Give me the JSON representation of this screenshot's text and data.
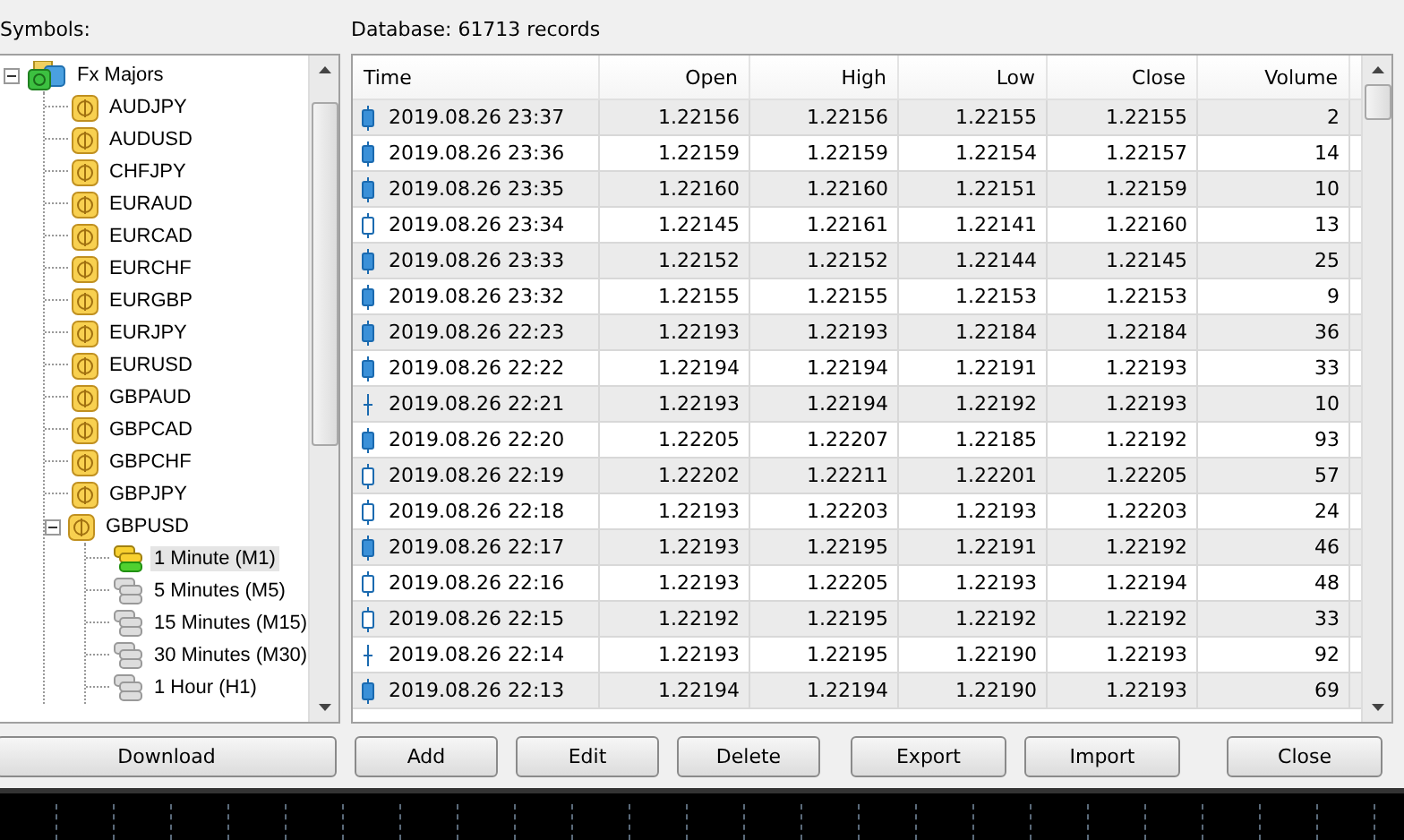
{
  "symbols_label": "Symbols:",
  "tree": [
    {
      "label": "Fx Majors",
      "kind": "folder",
      "expanded": true,
      "selected": false,
      "children": [
        {
          "label": "AUDJPY",
          "kind": "symbol",
          "selected": false
        },
        {
          "label": "AUDUSD",
          "kind": "symbol",
          "selected": false
        },
        {
          "label": "CHFJPY",
          "kind": "symbol",
          "selected": false
        },
        {
          "label": "EURAUD",
          "kind": "symbol",
          "selected": false
        },
        {
          "label": "EURCAD",
          "kind": "symbol",
          "selected": false
        },
        {
          "label": "EURCHF",
          "kind": "symbol",
          "selected": false
        },
        {
          "label": "EURGBP",
          "kind": "symbol",
          "selected": false
        },
        {
          "label": "EURJPY",
          "kind": "symbol",
          "selected": false
        },
        {
          "label": "EURUSD",
          "kind": "symbol",
          "selected": false
        },
        {
          "label": "GBPAUD",
          "kind": "symbol",
          "selected": false
        },
        {
          "label": "GBPCAD",
          "kind": "symbol",
          "selected": false
        },
        {
          "label": "GBPCHF",
          "kind": "symbol",
          "selected": false
        },
        {
          "label": "GBPJPY",
          "kind": "symbol",
          "selected": false
        },
        {
          "label": "GBPUSD",
          "kind": "symbol",
          "expanded": true,
          "selected": false,
          "children": [
            {
              "label": "1 Minute (M1)",
              "kind": "data",
              "selected": true
            },
            {
              "label": "5 Minutes (M5)",
              "kind": "empty",
              "selected": false
            },
            {
              "label": "15 Minutes (M15)",
              "kind": "empty",
              "selected": false
            },
            {
              "label": "30 Minutes (M30)",
              "kind": "empty",
              "selected": false
            },
            {
              "label": "1 Hour (H1)",
              "kind": "empty",
              "selected": false
            }
          ]
        }
      ]
    }
  ],
  "database_label": "Database: 61713 records",
  "table": {
    "columns": [
      "Time",
      "Open",
      "High",
      "Low",
      "Close",
      "Volume"
    ],
    "rows": [
      {
        "kind": "bear",
        "cells": [
          "2019.08.26 23:37",
          "1.22156",
          "1.22156",
          "1.22155",
          "1.22155",
          "2"
        ]
      },
      {
        "kind": "bear",
        "cells": [
          "2019.08.26 23:36",
          "1.22159",
          "1.22159",
          "1.22154",
          "1.22157",
          "14"
        ]
      },
      {
        "kind": "bear",
        "cells": [
          "2019.08.26 23:35",
          "1.22160",
          "1.22160",
          "1.22151",
          "1.22159",
          "10"
        ]
      },
      {
        "kind": "bull",
        "cells": [
          "2019.08.26 23:34",
          "1.22145",
          "1.22161",
          "1.22141",
          "1.22160",
          "13"
        ]
      },
      {
        "kind": "bear",
        "cells": [
          "2019.08.26 23:33",
          "1.22152",
          "1.22152",
          "1.22144",
          "1.22145",
          "25"
        ]
      },
      {
        "kind": "bear",
        "cells": [
          "2019.08.26 23:32",
          "1.22155",
          "1.22155",
          "1.22153",
          "1.22153",
          "9"
        ]
      },
      {
        "kind": "bear",
        "cells": [
          "2019.08.26 22:23",
          "1.22193",
          "1.22193",
          "1.22184",
          "1.22184",
          "36"
        ]
      },
      {
        "kind": "bear",
        "cells": [
          "2019.08.26 22:22",
          "1.22194",
          "1.22194",
          "1.22191",
          "1.22193",
          "33"
        ]
      },
      {
        "kind": "doji",
        "cells": [
          "2019.08.26 22:21",
          "1.22193",
          "1.22194",
          "1.22192",
          "1.22193",
          "10"
        ]
      },
      {
        "kind": "bear",
        "cells": [
          "2019.08.26 22:20",
          "1.22205",
          "1.22207",
          "1.22185",
          "1.22192",
          "93"
        ]
      },
      {
        "kind": "bull",
        "cells": [
          "2019.08.26 22:19",
          "1.22202",
          "1.22211",
          "1.22201",
          "1.22205",
          "57"
        ]
      },
      {
        "kind": "bull",
        "cells": [
          "2019.08.26 22:18",
          "1.22193",
          "1.22203",
          "1.22193",
          "1.22203",
          "24"
        ]
      },
      {
        "kind": "bear",
        "cells": [
          "2019.08.26 22:17",
          "1.22193",
          "1.22195",
          "1.22191",
          "1.22192",
          "46"
        ]
      },
      {
        "kind": "bull",
        "cells": [
          "2019.08.26 22:16",
          "1.22193",
          "1.22205",
          "1.22193",
          "1.22194",
          "48"
        ]
      },
      {
        "kind": "bull",
        "cells": [
          "2019.08.26 22:15",
          "1.22192",
          "1.22195",
          "1.22192",
          "1.22192",
          "33"
        ]
      },
      {
        "kind": "doji",
        "cells": [
          "2019.08.26 22:14",
          "1.22193",
          "1.22195",
          "1.22190",
          "1.22193",
          "92"
        ]
      },
      {
        "kind": "bear",
        "cells": [
          "2019.08.26 22:13",
          "1.22194",
          "1.22194",
          "1.22190",
          "1.22193",
          "69"
        ]
      }
    ]
  },
  "buttons": {
    "download": "Download",
    "actions": [
      "Add",
      "Edit",
      "Delete",
      "Export",
      "Import"
    ],
    "close": "Close"
  }
}
